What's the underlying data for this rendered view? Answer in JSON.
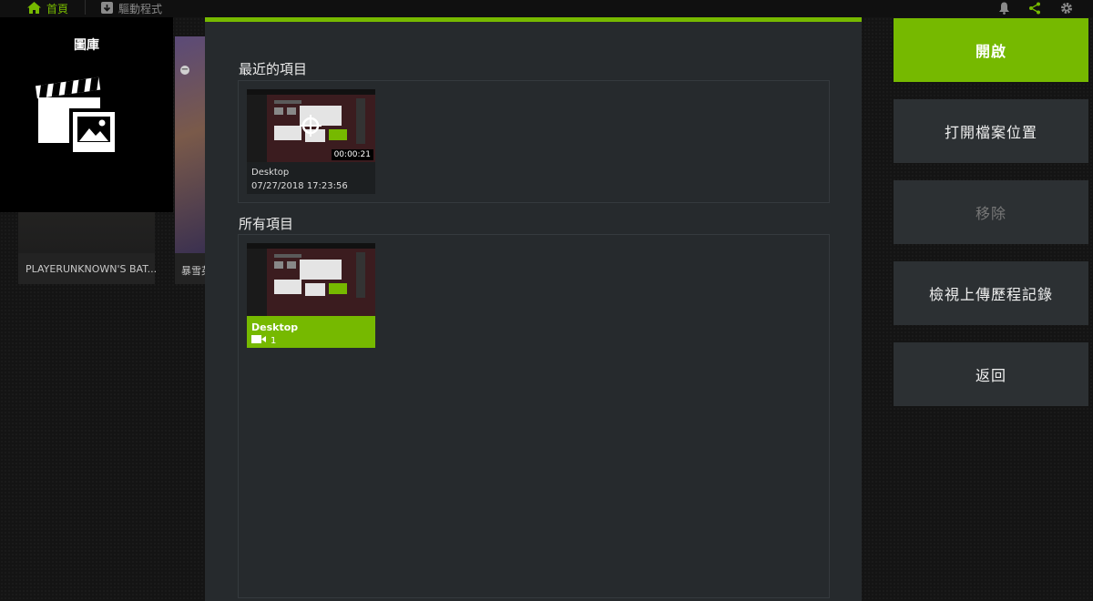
{
  "topbar": {
    "home_label": "首頁",
    "drivers_label": "驅動程式",
    "accent_color": "#76b900"
  },
  "background_games": [
    {
      "title": "PLAYERUNKNOWN'S BAT..."
    },
    {
      "title": "暴雪英"
    }
  ],
  "gallery": {
    "title": "圖庫",
    "icon": "clapperboard-image-icon"
  },
  "dialog": {
    "recent_title": "最近的項目",
    "recent_items": [
      {
        "name": "Desktop",
        "date": "07/27/2018 17:23:56",
        "duration": "00:00:21"
      }
    ],
    "all_title": "所有項目",
    "all_items": [
      {
        "name": "Desktop",
        "count": "1",
        "selected": true
      }
    ]
  },
  "actions": {
    "open": "開啟",
    "open_location": "打開檔案位置",
    "remove": "移除",
    "upload_history": "檢視上傳歷程記錄",
    "back": "返回"
  }
}
